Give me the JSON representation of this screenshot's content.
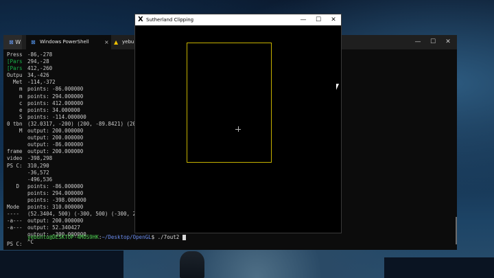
{
  "back_window": {
    "tab_title": "W"
  },
  "terminal": {
    "tabs": [
      {
        "label": "Windows PowerShell",
        "close": "×"
      },
      {
        "label": "yebu"
      }
    ],
    "controls": {
      "minimize": "—",
      "maximize": "☐",
      "close": "✕"
    },
    "left_column": [
      "Press",
      "[Pars",
      "[Pars",
      "Outpu",
      "  Met",
      "    m",
      "    m",
      "    c",
      "    e",
      "    S",
      "0 tbn",
      "    M",
      "",
      "",
      "frame",
      "video",
      "PS C:",
      "",
      "",
      "   D",
      "",
      "",
      "Mode",
      "----",
      "-a---",
      "-a---"
    ],
    "left_green_rows": [
      1,
      2
    ],
    "output_lines": [
      "-86,-278",
      "294,-28",
      "412,-260",
      "34,-426",
      "-114,-372",
      "points: -86.000000",
      "points: 294.000000",
      "points: 412.000000",
      "points: 34.000000",
      "points: -114.000000",
      "(32.0317, -200) (200, -89.8421) (20",
      "output: 200.000000",
      "output: 200.000000",
      "output: -86.000000",
      "output: 200.000000",
      "-398,298",
      "310,290",
      "-36,572",
      "-496,536",
      "points: -86.000000",
      "points: 294.000000",
      "points: -398.000000",
      "points: 310.000000",
      "(52.3404, 500) (-300, 500) (-300, 2",
      "output: 200.000000",
      "output: 52.340427",
      "output: -300.000000",
      "^C"
    ],
    "prompt": {
      "user": "yebuntu@DESKTOP-4MOS9HK",
      "sep": ":",
      "path": "~/Desktop/OpenGL",
      "dollar": "$ ",
      "command": "./7out2"
    },
    "ps_prompt": "PS C:"
  },
  "x_window": {
    "title": "Sutherland Clipping",
    "logo": "X",
    "controls": {
      "minimize": "—",
      "maximize": "☐",
      "close": "✕"
    },
    "clip_color": "#c8b400"
  }
}
